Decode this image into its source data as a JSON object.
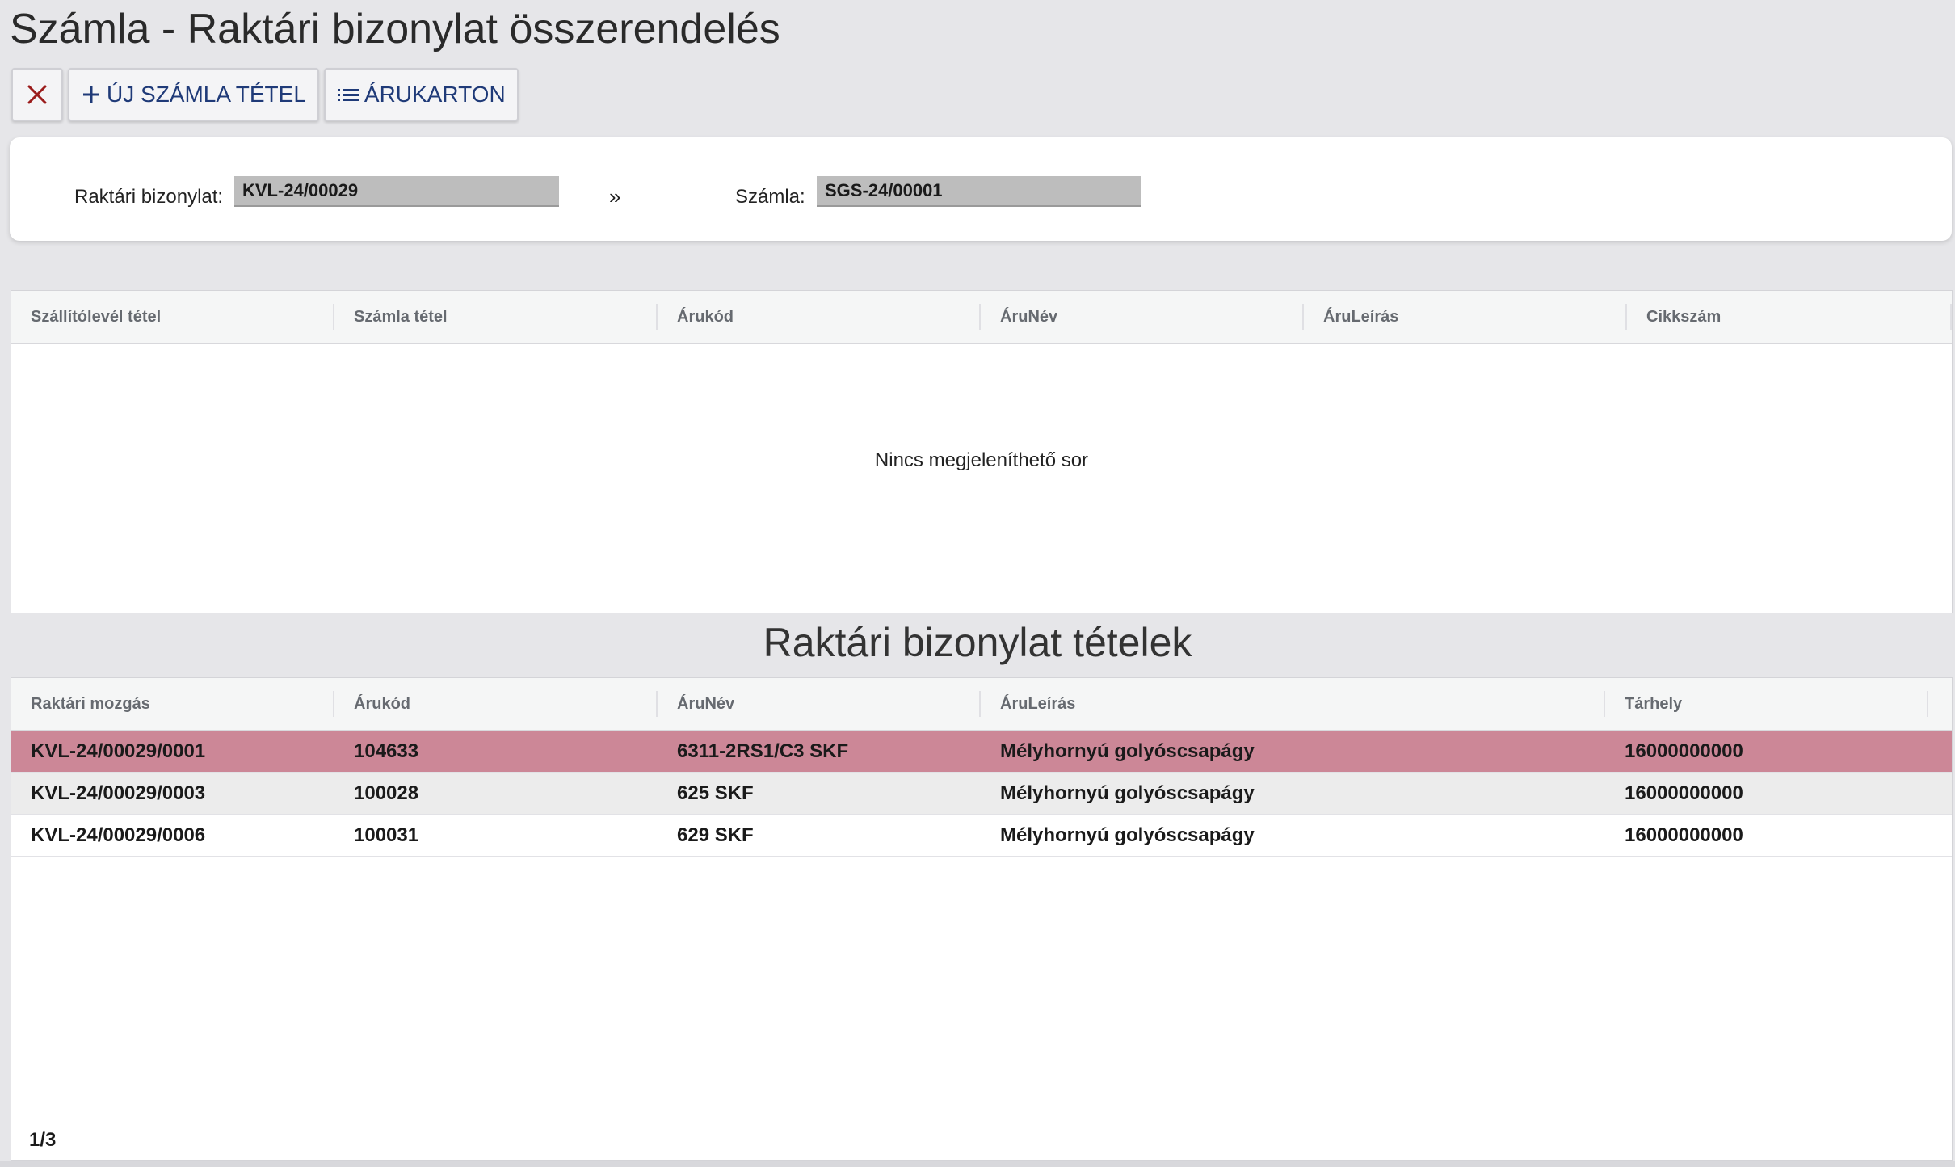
{
  "page": {
    "title": "Számla - Raktári bizonylat összerendelés"
  },
  "toolbar": {
    "close_icon": "close-icon",
    "new_invoice_item_label": "ÚJ SZÁMLA TÉTEL",
    "product_card_label": "ÁRUKARTON"
  },
  "filter": {
    "warehouse_doc_label": "Raktári bizonylat:",
    "warehouse_doc_value": "KVL-24/00029",
    "arrow": "»",
    "invoice_label": "Számla:",
    "invoice_value": "SGS-24/00001"
  },
  "match_grid": {
    "columns": [
      "Szállítólevél tétel",
      "Számla tétel",
      "Árukód",
      "ÁruNév",
      "ÁruLeírás",
      "Cikkszám"
    ],
    "empty_message": "Nincs megjeleníthető sor"
  },
  "items_section": {
    "title": "Raktári bizonylat tételek",
    "columns": [
      "Raktári mozgás",
      "Árukód",
      "ÁruNév",
      "ÁruLeírás",
      "Tárhely"
    ],
    "rows": [
      {
        "movement": "KVL-24/00029/0001",
        "code": "104633",
        "name": "6311-2RS1/C3 SKF",
        "description": "Mélyhornyú golyóscsapágy",
        "storage": "16000000000"
      },
      {
        "movement": "KVL-24/00029/0003",
        "code": "100028",
        "name": "625 SKF",
        "description": "Mélyhornyú golyóscsapágy",
        "storage": "16000000000"
      },
      {
        "movement": "KVL-24/00029/0006",
        "code": "100031",
        "name": "629 SKF",
        "description": "Mélyhornyú golyóscsapágy",
        "storage": "16000000000"
      }
    ],
    "pager": "1/3"
  },
  "colors": {
    "selected_row": "#cc8797",
    "button_text": "#1f3a78",
    "close_icon": "#9b1c1c"
  }
}
